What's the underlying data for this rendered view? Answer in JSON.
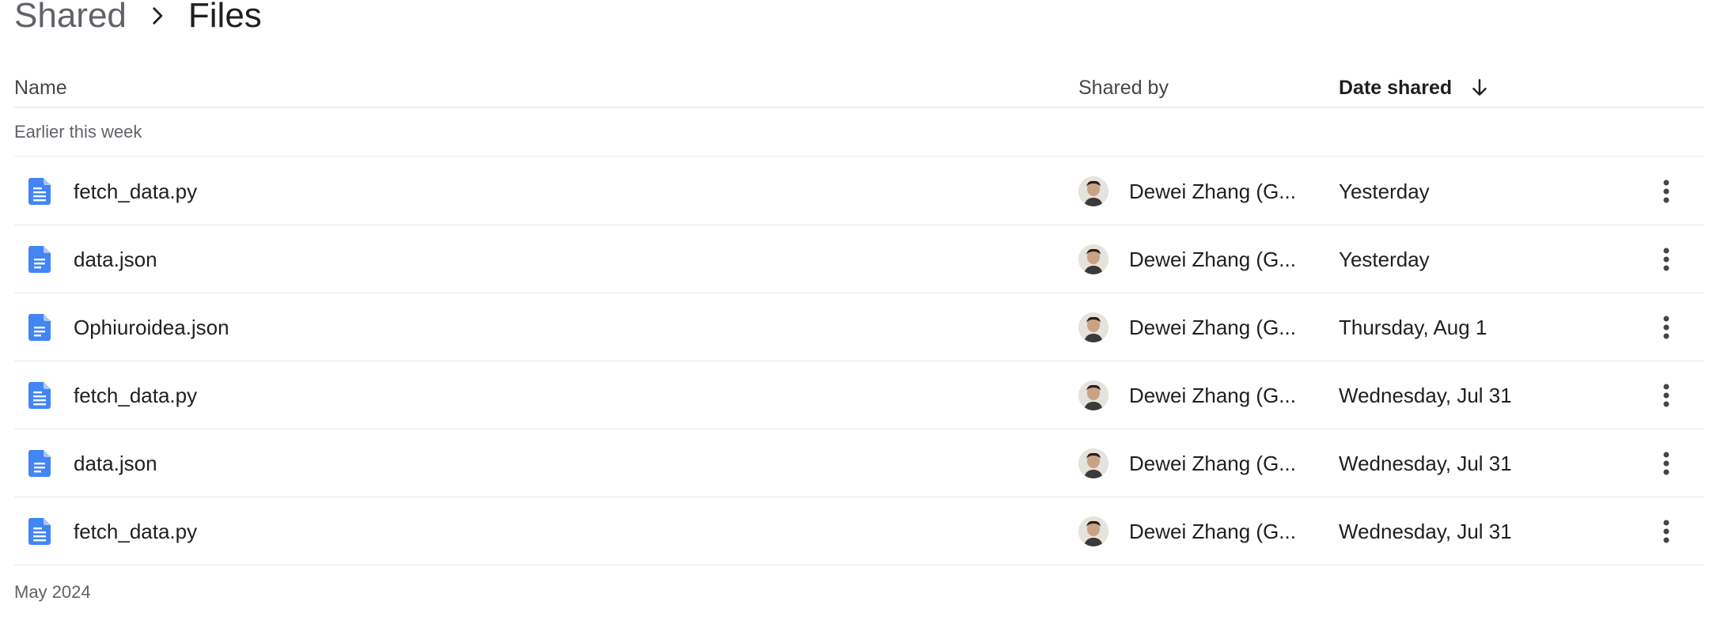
{
  "breadcrumb": {
    "parent": "Shared",
    "current": "Files"
  },
  "table": {
    "columns": {
      "name": "Name",
      "shared_by": "Shared by",
      "date_shared": "Date shared"
    },
    "sort": {
      "column": "Date shared",
      "direction": "descending",
      "icon": "arrow-down-icon"
    }
  },
  "groups": [
    {
      "label": "Earlier this week"
    },
    {
      "label": "May 2024"
    }
  ],
  "rows": [
    {
      "name": "fetch_data.py",
      "icon": "text-file-icon",
      "shared_by": "Dewei Zhang (G...",
      "date": "Yesterday"
    },
    {
      "name": "data.json",
      "icon": "document-icon",
      "shared_by": "Dewei Zhang (G...",
      "date": "Yesterday"
    },
    {
      "name": "Ophiuroidea.json",
      "icon": "document-icon",
      "shared_by": "Dewei Zhang (G...",
      "date": "Thursday, Aug 1"
    },
    {
      "name": "fetch_data.py",
      "icon": "text-file-icon",
      "shared_by": "Dewei Zhang (G...",
      "date": "Wednesday, Jul 31"
    },
    {
      "name": "data.json",
      "icon": "document-icon",
      "shared_by": "Dewei Zhang (G...",
      "date": "Wednesday, Jul 31"
    },
    {
      "name": "fetch_data.py",
      "icon": "text-file-icon",
      "shared_by": "Dewei Zhang (G...",
      "date": "Wednesday, Jul 31"
    }
  ],
  "colors": {
    "file_icon_blue": "#4285f4",
    "text_primary": "#1f1f1f",
    "text_secondary": "#5f6368"
  }
}
